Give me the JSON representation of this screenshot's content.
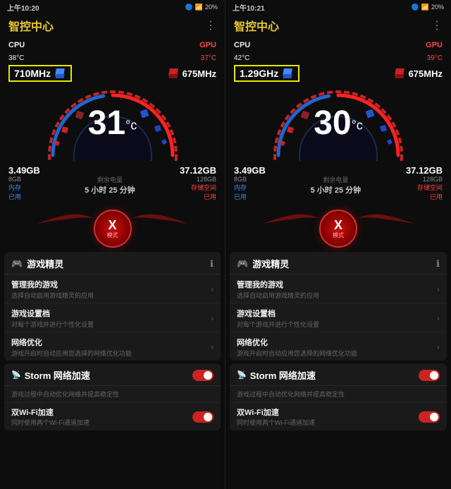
{
  "left_panel": {
    "status": {
      "time": "上午10:20",
      "signal": "▼",
      "bluetooth": "🔵",
      "wifi": "WiFi",
      "battery": "20%"
    },
    "header": {
      "title": "智控中心",
      "menu": "⋮"
    },
    "dashboard": {
      "cpu_label": "CPU",
      "cpu_temp": "38°C",
      "gpu_label": "GPU",
      "gpu_temp": "37°C",
      "cpu_freq": "710MHz",
      "gpu_freq": "675MHz",
      "temperature": "31",
      "temp_unit": "c",
      "memory_used": "3.49GB",
      "memory_total": "8GB",
      "memory_label": "内存",
      "memory_label2": "已用",
      "storage_used": "37.12GB",
      "storage_total": "128GB",
      "storage_label": "存储空间",
      "storage_label2": "已用",
      "battery_label": "剩余电量",
      "battery_time": "5 小时 25 分钟"
    },
    "x_mode": {
      "x": "X",
      "label": "模式"
    },
    "game_fairy": {
      "title": "游戏精灵",
      "item1_title": "管理我的游戏",
      "item1_desc": "选择自动启用游戏精灵的应用",
      "item2_title": "游戏设置档",
      "item2_desc": "对每个游戏并进行个性化设置",
      "item3_title": "网络优化",
      "item3_desc": "游戏开启时自动应用您选择的网络优化功能"
    },
    "storm": {
      "title": "Storm 网络加速",
      "item1_title": "游戏过程中自动优化网络并提高稳定性",
      "item2_title": "双Wi-Fi加速",
      "item2_desc": "同时使用两个Wi-Fi通道加速"
    }
  },
  "right_panel": {
    "status": {
      "time": "上午10:21",
      "signal": "▼",
      "bluetooth": "🔵",
      "wifi": "WiFi",
      "battery": "20%"
    },
    "header": {
      "title": "智控中心",
      "menu": "⋮"
    },
    "dashboard": {
      "cpu_label": "CPU",
      "cpu_temp": "42°C",
      "gpu_label": "GPU",
      "gpu_temp": "39°C",
      "cpu_freq": "1.29GHz",
      "gpu_freq": "675MHz",
      "temperature": "30",
      "temp_unit": "c",
      "memory_used": "3.49GB",
      "memory_total": "8GB",
      "memory_label": "内存",
      "memory_label2": "已用",
      "storage_used": "37.12GB",
      "storage_total": "128GB",
      "storage_label": "存储空间",
      "storage_label2": "已用",
      "battery_label": "剩余电量",
      "battery_time": "5 小时 25 分钟"
    },
    "x_mode": {
      "x": "X",
      "label": "模式"
    },
    "game_fairy": {
      "title": "游戏精灵",
      "item1_title": "管理我的游戏",
      "item1_desc": "选择自动启用游戏精灵的应用",
      "item2_title": "游戏设置档",
      "item2_desc": "对每个游戏并进行个性化设置",
      "item3_title": "网络优化",
      "item3_desc": "游戏开启时自动应用您选择的网络优化功能"
    },
    "storm": {
      "title": "Storm 网络加速",
      "item1_title": "游戏过程中自动优化网络并提高稳定性",
      "item2_title": "双Wi-Fi加速",
      "item2_desc": "同时使用两个Wi-Fi通道加速"
    }
  }
}
